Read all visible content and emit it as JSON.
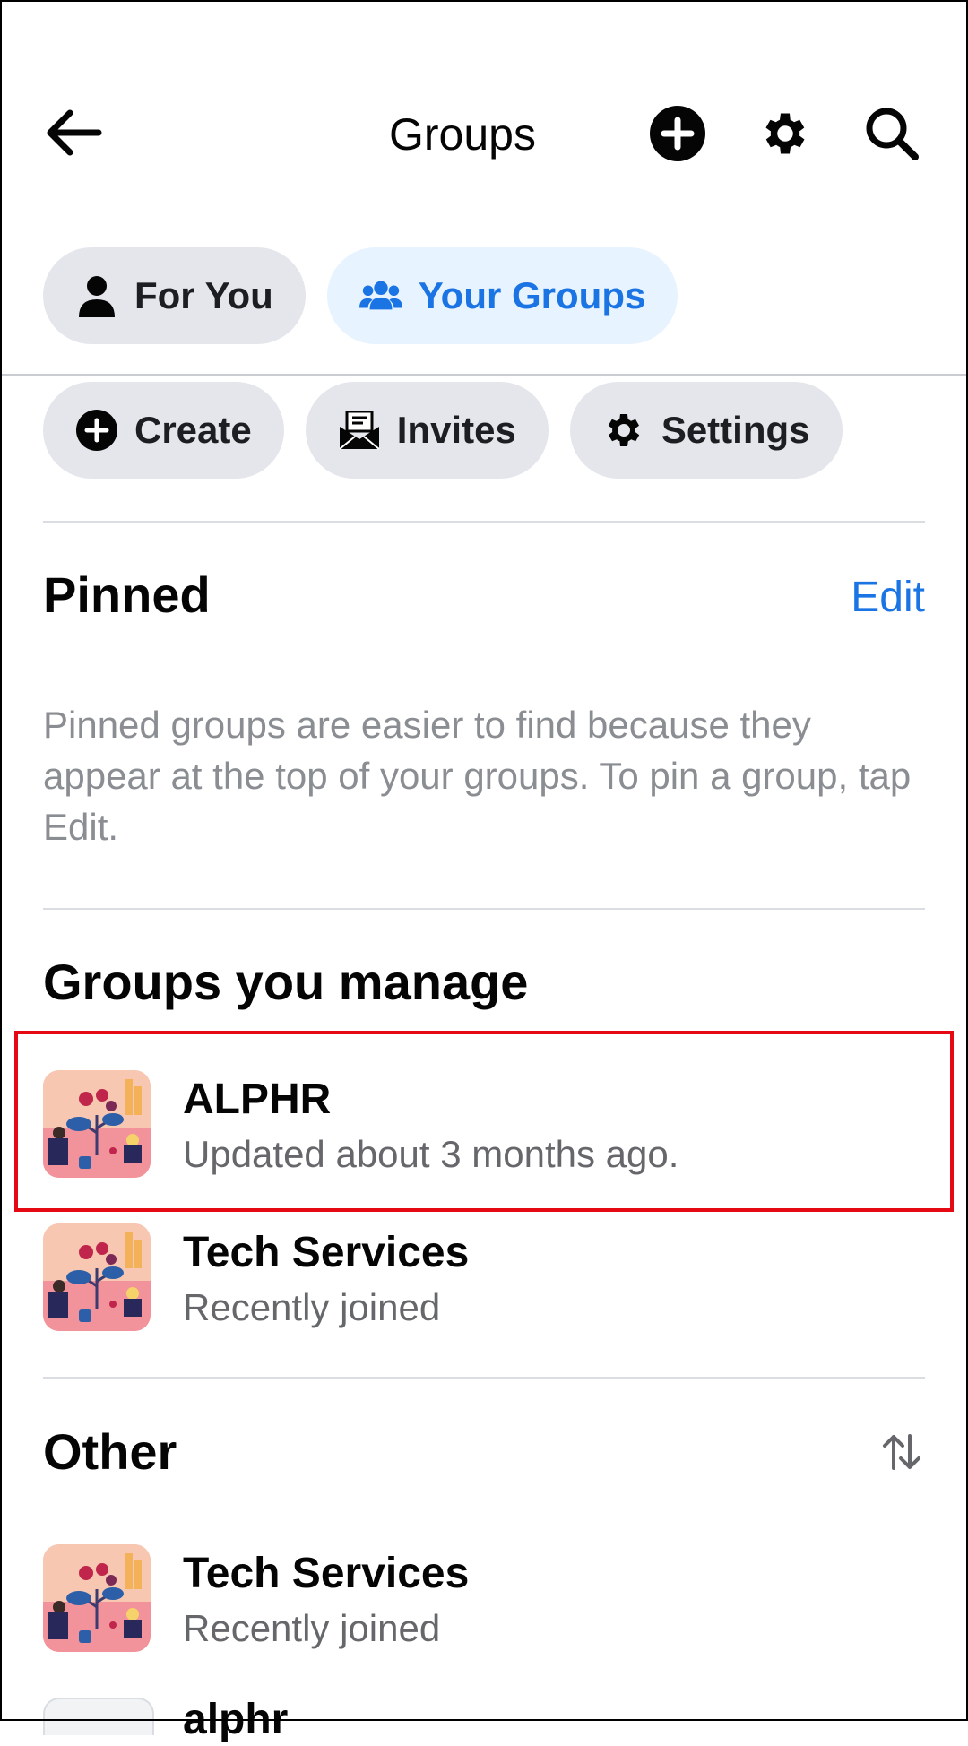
{
  "header": {
    "title": "Groups",
    "back_icon": "arrow-left-icon",
    "actions": [
      "plus-circle-icon",
      "gear-icon",
      "search-icon"
    ]
  },
  "tabs": [
    {
      "label": "For You",
      "icon": "person-icon",
      "active": false
    },
    {
      "label": "Your Groups",
      "icon": "people-icon",
      "active": true
    }
  ],
  "actions": [
    {
      "label": "Create",
      "icon": "plus-circle-icon"
    },
    {
      "label": "Invites",
      "icon": "envelope-icon"
    },
    {
      "label": "Settings",
      "icon": "gear-icon"
    }
  ],
  "pinned": {
    "title": "Pinned",
    "edit_label": "Edit",
    "description": "Pinned groups are easier to find because they appear at the top of your groups. To pin a group, tap Edit."
  },
  "managed": {
    "title": "Groups you manage",
    "groups": [
      {
        "name": "ALPHR",
        "subtitle": "Updated about 3 months ago."
      },
      {
        "name": "Tech Services",
        "subtitle": "Recently joined"
      }
    ]
  },
  "other": {
    "title": "Other",
    "sort_icon": "sort-arrows-icon",
    "groups": [
      {
        "name": "Tech Services",
        "subtitle": "Recently joined"
      },
      {
        "name": "alphr",
        "subtitle": ""
      }
    ]
  },
  "colors": {
    "accent": "#1b74e4",
    "active_tab_bg": "#e7f3ff",
    "chip_bg": "#e4e6eb",
    "highlight": "#e50914"
  }
}
